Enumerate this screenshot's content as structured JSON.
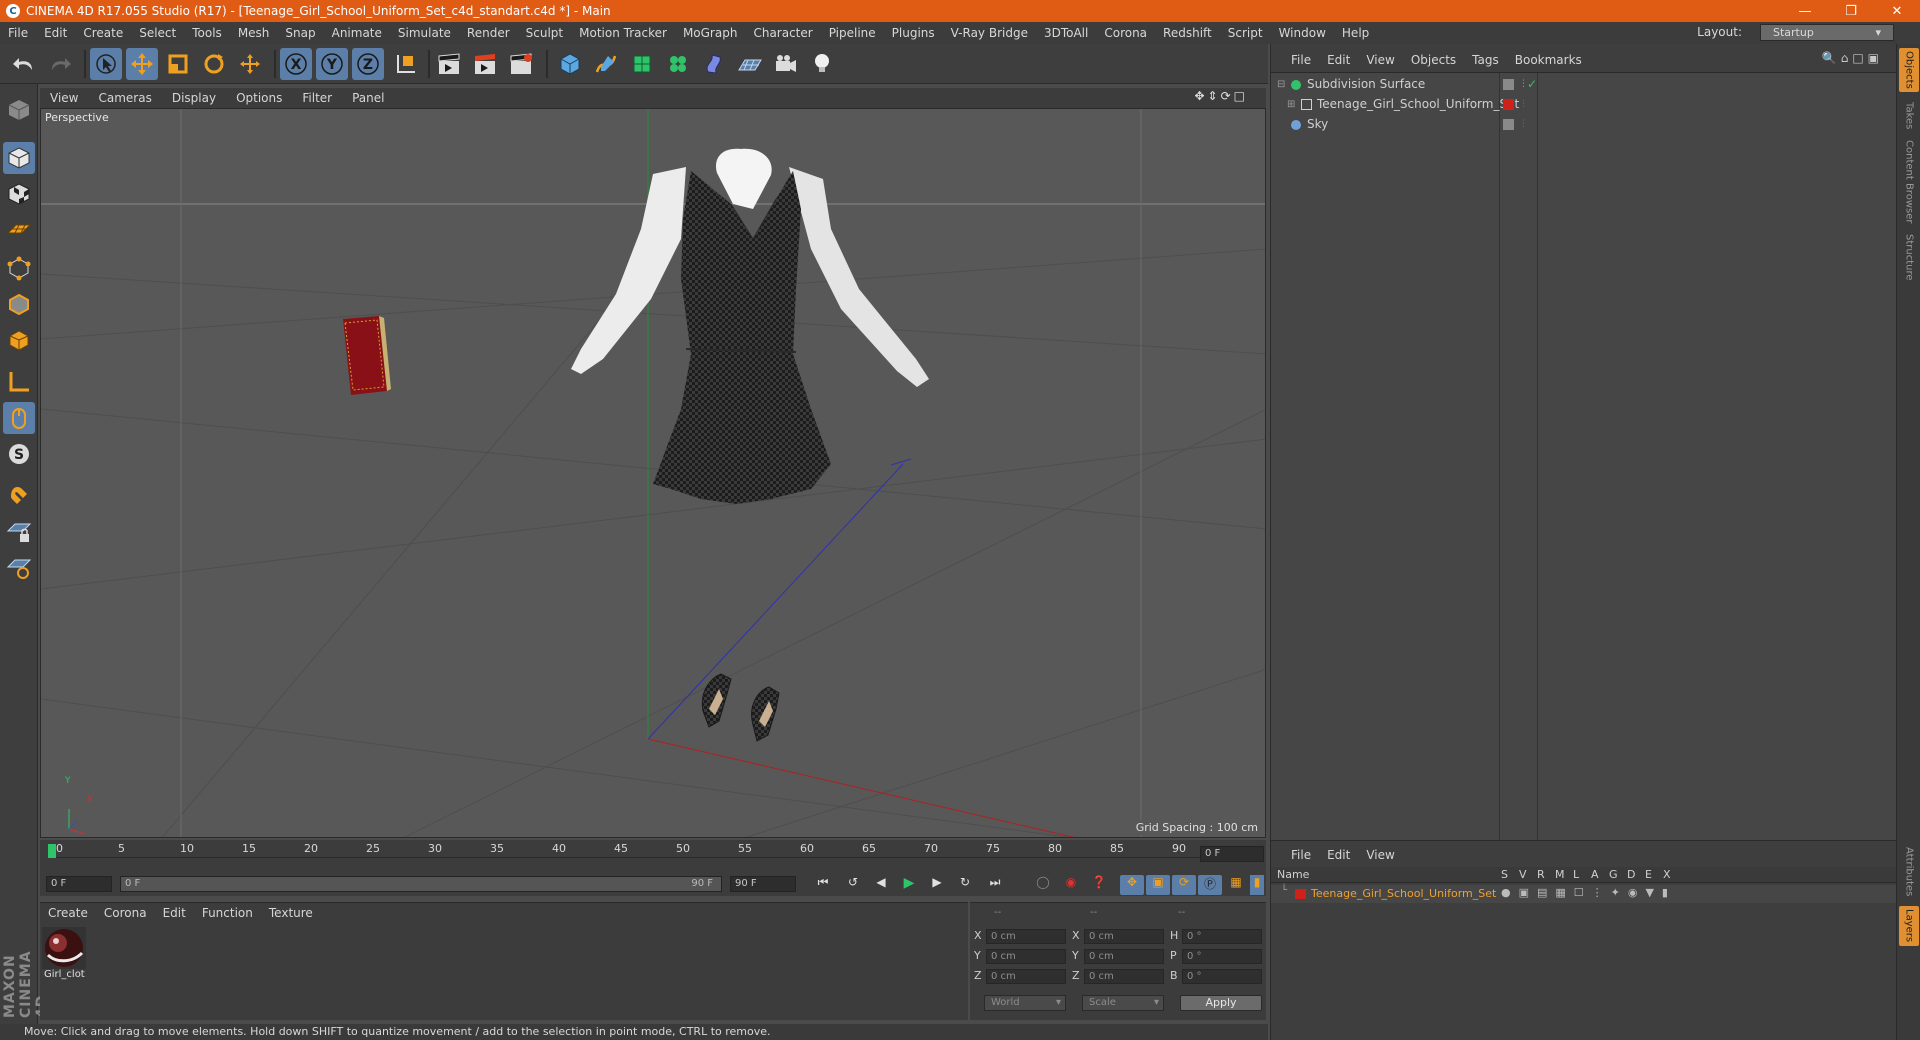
{
  "window": {
    "title": "CINEMA 4D R17.055 Studio (R17) - [Teenage_Girl_School_Uniform_Set_c4d_standart.c4d *] - Main",
    "icon_letter": "C"
  },
  "menubar": {
    "items": [
      "File",
      "Edit",
      "Create",
      "Select",
      "Tools",
      "Mesh",
      "Snap",
      "Animate",
      "Simulate",
      "Render",
      "Sculpt",
      "Motion Tracker",
      "MoGraph",
      "Character",
      "Pipeline",
      "Plugins",
      "V-Ray Bridge",
      "3DToAll",
      "Corona",
      "Redshift",
      "Script",
      "Window",
      "Help"
    ],
    "layout_label": "Layout:",
    "layout_value": "Startup"
  },
  "viewport": {
    "menu": [
      "View",
      "Cameras",
      "Display",
      "Options",
      "Filter",
      "Panel"
    ],
    "label": "Perspective",
    "grid_spacing": "Grid Spacing : 100 cm",
    "axis_y": "Y",
    "axis_x": "X"
  },
  "timeline": {
    "ticks": [
      "0",
      "5",
      "10",
      "15",
      "20",
      "25",
      "30",
      "35",
      "40",
      "45",
      "50",
      "55",
      "60",
      "65",
      "70",
      "75",
      "80",
      "85",
      "90"
    ],
    "current_frame": "0 F",
    "start_field": "0 F",
    "range_start": "0 F",
    "range_end": "90 F",
    "end_field": "90 F"
  },
  "material_panel": {
    "menu": [
      "Create",
      "Corona",
      "Edit",
      "Function",
      "Texture"
    ],
    "material_name": "Girl_clot"
  },
  "coord_panel": {
    "headers": [
      "--",
      "--",
      "--"
    ],
    "rows": [
      {
        "l1": "X",
        "v1": "0 cm",
        "l2": "X",
        "v2": "0 cm",
        "l3": "H",
        "v3": "0 °"
      },
      {
        "l1": "Y",
        "v1": "0 cm",
        "l2": "Y",
        "v2": "0 cm",
        "l3": "P",
        "v3": "0 °"
      },
      {
        "l1": "Z",
        "v1": "0 cm",
        "l2": "Z",
        "v2": "0 cm",
        "l3": "B",
        "v3": "0 °"
      }
    ],
    "mode1": "World",
    "mode2": "Scale",
    "apply": "Apply"
  },
  "status": "Move: Click and drag to move elements. Hold down SHIFT to quantize movement / add to the selection in point mode, CTRL to remove.",
  "object_manager": {
    "menu": [
      "File",
      "Edit",
      "View",
      "Objects",
      "Tags",
      "Bookmarks"
    ],
    "objects": [
      {
        "name": "Subdivision Surface",
        "color": "#2fc46a"
      },
      {
        "name": "Teenage_Girl_School_Uniform_Set",
        "color": "#d0d0d0"
      },
      {
        "name": "Sky",
        "color": "#6fa0d8"
      }
    ]
  },
  "layer_manager": {
    "menu": [
      "File",
      "Edit",
      "View"
    ],
    "name_header": "Name",
    "columns": [
      "S",
      "V",
      "R",
      "M",
      "L",
      "A",
      "G",
      "D",
      "E",
      "X"
    ],
    "layer_name": "Teenage_Girl_School_Uniform_Set",
    "layer_color": "#d0201a"
  },
  "side_tabs": [
    "Objects",
    "Takes",
    "Content Browser",
    "Structure"
  ],
  "side_tabs_bottom": [
    "Attributes",
    "Layers"
  ],
  "branding": "MAXON CINEMA 4D",
  "colors": {
    "accent": "#e05c14",
    "selection": "#5b7fa8",
    "layer_text": "#f0a030"
  }
}
